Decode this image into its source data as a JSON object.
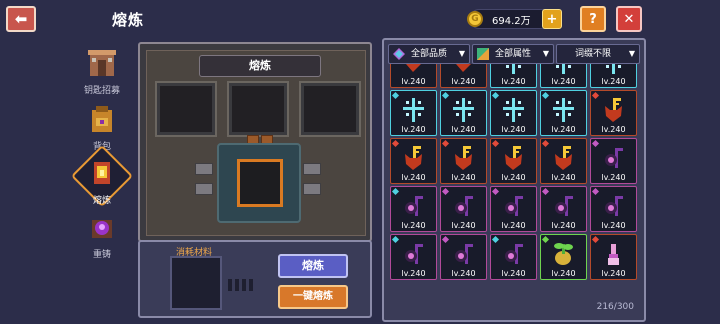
{
  "header": {
    "title": "熔炼",
    "coins": "694.2万",
    "help_label": "?",
    "close_label": "✕",
    "add_label": "+",
    "back_label": "⬅"
  },
  "nav": {
    "items": [
      {
        "label": "钥匙招募",
        "icon": "shrine-icon"
      },
      {
        "label": "背包",
        "icon": "backpack-icon"
      },
      {
        "label": "熔炼",
        "icon": "furnace-icon"
      },
      {
        "label": "重铸",
        "icon": "recast-icon"
      }
    ],
    "active": "熔炼"
  },
  "smelter": {
    "title": "熔炼"
  },
  "materials": {
    "label": "消耗材料",
    "smelt_button": "熔炼",
    "one_click_button": "一键熔炼"
  },
  "inventory": {
    "filters": [
      "全部品质",
      "全部属性",
      "词缀不限"
    ],
    "count": "216/300",
    "items": [
      {
        "level": "lv.240",
        "kind": "demon",
        "tag": "red"
      },
      {
        "level": "lv.240",
        "kind": "demon",
        "tag": "red"
      },
      {
        "level": "lv.240",
        "kind": "ice",
        "tag": "cyan"
      },
      {
        "level": "lv.240",
        "kind": "ice",
        "tag": "cyan"
      },
      {
        "level": "lv.240",
        "kind": "ice",
        "tag": "cyan"
      },
      {
        "level": "lv.240",
        "kind": "ice",
        "tag": "cyan"
      },
      {
        "level": "lv.240",
        "kind": "ice",
        "tag": "cyan"
      },
      {
        "level": "lv.240",
        "kind": "ice",
        "tag": "cyan"
      },
      {
        "level": "lv.240",
        "kind": "ice",
        "tag": "cyan"
      },
      {
        "level": "lv.240",
        "kind": "demonF",
        "tag": "red"
      },
      {
        "level": "lv.240",
        "kind": "demonF",
        "tag": "red"
      },
      {
        "level": "lv.240",
        "kind": "demonF",
        "tag": "red"
      },
      {
        "level": "lv.240",
        "kind": "demonF",
        "tag": "red"
      },
      {
        "level": "lv.240",
        "kind": "demonF",
        "tag": "red"
      },
      {
        "level": "lv.240",
        "kind": "staff",
        "tag": "purple"
      },
      {
        "level": "lv.240",
        "kind": "staff",
        "tag": "cyan"
      },
      {
        "level": "lv.240",
        "kind": "staff",
        "tag": "purple"
      },
      {
        "level": "lv.240",
        "kind": "staff",
        "tag": "purple"
      },
      {
        "level": "lv.240",
        "kind": "staff",
        "tag": "purple"
      },
      {
        "level": "lv.240",
        "kind": "staff",
        "tag": "purple"
      },
      {
        "level": "lv.240",
        "kind": "staff",
        "tag": "cyan"
      },
      {
        "level": "lv.240",
        "kind": "staff",
        "tag": "purple"
      },
      {
        "level": "lv.240",
        "kind": "staff",
        "tag": "cyan"
      },
      {
        "level": "lv.240",
        "kind": "plant",
        "tag": "green"
      },
      {
        "level": "lv.240",
        "kind": "brush",
        "tag": "red"
      }
    ]
  },
  "colors": {
    "bg": "#2c2d4a",
    "accent_orange": "#e07f22",
    "accent_red": "#d33f3a",
    "button_blue": "#5a5ec4"
  }
}
